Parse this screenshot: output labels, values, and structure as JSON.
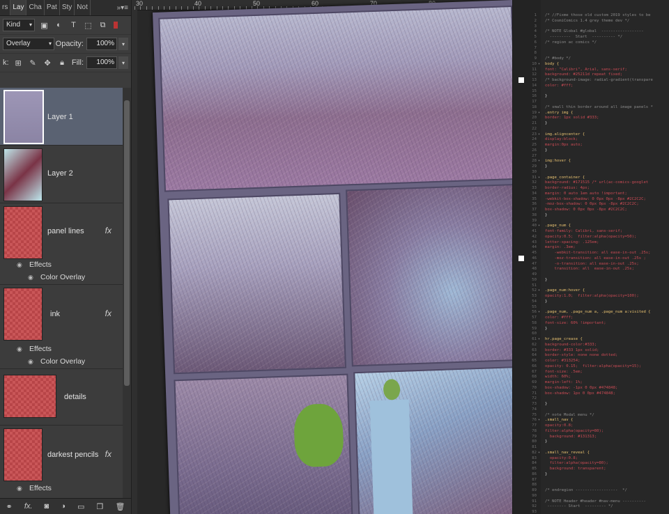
{
  "layers_panel": {
    "tabs": [
      "rs",
      "Lay",
      "Cha",
      "Pat",
      "Sty",
      "Not"
    ],
    "filter_kind": "Kind",
    "blend_mode": "Overlay",
    "opacity_label": "Opacity:",
    "opacity_value": "100%",
    "lock_label": "k:",
    "fill_label": "Fill:",
    "fill_value": "100%",
    "layers": [
      {
        "name": "Layer 1",
        "fx": "",
        "effects": []
      },
      {
        "name": "Layer 2",
        "fx": "",
        "effects": []
      },
      {
        "name": "panel lines",
        "fx": "fx",
        "effects": [
          "Effects",
          "Color Overlay"
        ]
      },
      {
        "name": "ink",
        "fx": "fx",
        "effects": [
          "Effects",
          "Color Overlay"
        ]
      },
      {
        "name": "details",
        "fx": "",
        "effects": []
      },
      {
        "name": "darkest pencils",
        "fx": "fx",
        "effects": [
          "Effects"
        ]
      }
    ],
    "footer_icons": [
      "link-icon",
      "fx-icon",
      "mask-icon",
      "adjustment-icon",
      "folder-icon",
      "new-layer-icon",
      "trash-icon"
    ]
  },
  "ruler": {
    "ticks": [
      "30",
      "40",
      "50",
      "60",
      "70",
      "80",
      "90"
    ]
  },
  "editor": {
    "swatches": [
      {
        "line": 13,
        "color": "#ffffff"
      },
      {
        "line": 46,
        "color": "#ffffff"
      }
    ],
    "lines": [
      {
        "n": "1",
        "f": "",
        "t": "/* //Fixme those old custom 2019 styles to be",
        "k": "com"
      },
      {
        "n": "2",
        "f": "",
        "t": "/* CosmiComics 1.4 grey theme dev */",
        "k": "com"
      },
      {
        "n": "3",
        "f": "",
        "t": "",
        "k": "com"
      },
      {
        "n": "4",
        "f": "",
        "t": "/* NOTE Global #global  ------------------",
        "k": "com"
      },
      {
        "n": "5",
        "f": "",
        "t": "  ---------  Start  ---------- */",
        "k": "com"
      },
      {
        "n": "6",
        "f": "",
        "t": "/* region ac comics */",
        "k": "com"
      },
      {
        "n": "7",
        "f": "",
        "t": "",
        "k": "com"
      },
      {
        "n": "8",
        "f": "",
        "t": "",
        "k": "com"
      },
      {
        "n": "9",
        "f": "",
        "t": "/* #body */",
        "k": "com"
      },
      {
        "n": "10",
        "f": "▾",
        "t": "body {",
        "k": "sel"
      },
      {
        "n": "11",
        "f": "",
        "t": "font: \"Calibri\", Arial, sans-serif;",
        "k": "prop"
      },
      {
        "n": "12",
        "f": "",
        "t": "background: #25211d repeat fixed;",
        "k": "prop"
      },
      {
        "n": "13",
        "f": "",
        "t": "/* background-image: radial-gradient(transpare",
        "k": "com"
      },
      {
        "n": "14",
        "f": "",
        "t": "color: #fff;",
        "k": "prop"
      },
      {
        "n": "15",
        "f": "",
        "t": "",
        "k": "br"
      },
      {
        "n": "16",
        "f": "",
        "t": "}",
        "k": "br"
      },
      {
        "n": "17",
        "f": "",
        "t": "",
        "k": "br"
      },
      {
        "n": "18",
        "f": "",
        "t": "/* small thin border around all image panels *",
        "k": "com"
      },
      {
        "n": "19",
        "f": "▾",
        "t": ".entry img {",
        "k": "sel"
      },
      {
        "n": "20",
        "f": "",
        "t": "border: 1px solid #333;",
        "k": "prop"
      },
      {
        "n": "21",
        "f": "",
        "t": "}",
        "k": "br"
      },
      {
        "n": "22",
        "f": "",
        "t": "",
        "k": "br"
      },
      {
        "n": "23",
        "f": "▾",
        "t": "img.aligncenter {",
        "k": "sel"
      },
      {
        "n": "24",
        "f": "",
        "t": "display:block;",
        "k": "prop"
      },
      {
        "n": "25",
        "f": "",
        "t": "margin:0px auto;",
        "k": "prop"
      },
      {
        "n": "26",
        "f": "",
        "t": "}",
        "k": "br"
      },
      {
        "n": "27",
        "f": "",
        "t": "",
        "k": "br"
      },
      {
        "n": "28",
        "f": "▾",
        "t": "img:hover {",
        "k": "sel"
      },
      {
        "n": "29",
        "f": "",
        "t": "}",
        "k": "br"
      },
      {
        "n": "30",
        "f": "",
        "t": "",
        "k": "br"
      },
      {
        "n": "31",
        "f": "▾",
        "t": ".page_container {",
        "k": "sel"
      },
      {
        "n": "32",
        "f": "",
        "t": "background: #171515 /* url(ac-comics-googlet",
        "k": "prop"
      },
      {
        "n": "33",
        "f": "",
        "t": "border-radius: 4px;",
        "k": "prop"
      },
      {
        "n": "34",
        "f": "",
        "t": "margin: 0 auto 1em auto !important;",
        "k": "prop"
      },
      {
        "n": "35",
        "f": "",
        "t": "-webkit-box-shadow: 0 0px 0px -8px #2C2C2C;",
        "k": "prop"
      },
      {
        "n": "36",
        "f": "",
        "t": "-moz-box-shadow: 0 0px 0px -8px #2C2C2C;",
        "k": "prop"
      },
      {
        "n": "37",
        "f": "",
        "t": "box-shadow: 0 0px 0px -8px #2C2C2C;",
        "k": "prop"
      },
      {
        "n": "38",
        "f": "",
        "t": "}",
        "k": "br"
      },
      {
        "n": "39",
        "f": "",
        "t": "",
        "k": "br"
      },
      {
        "n": "40",
        "f": "▾",
        "t": ".page_num {",
        "k": "sel"
      },
      {
        "n": "41",
        "f": "",
        "t": "font-family: Calibri, sans-serif;",
        "k": "prop"
      },
      {
        "n": "42",
        "f": "",
        "t": "opacity:0.5;  filter:alpha(opacity=50);",
        "k": "prop"
      },
      {
        "n": "43",
        "f": "",
        "t": "letter-spacing: .125em;",
        "k": "prop"
      },
      {
        "n": "44",
        "f": "",
        "t": "margin: .3em;",
        "k": "prop"
      },
      {
        "n": "45",
        "f": "",
        "t": "    -webkit-transition: all ease-in-out .25s;",
        "k": "prop"
      },
      {
        "n": "46",
        "f": "",
        "t": "    -moz-transition: all ease-in-out .25s ;",
        "k": "prop"
      },
      {
        "n": "47",
        "f": "",
        "t": "    -o-transition: all ease-in-out .25s;",
        "k": "prop"
      },
      {
        "n": "48",
        "f": "",
        "t": "    transition: all  ease-in-out .25s;",
        "k": "prop"
      },
      {
        "n": "49",
        "f": "",
        "t": "",
        "k": "br"
      },
      {
        "n": "50",
        "f": "",
        "t": "}",
        "k": "br"
      },
      {
        "n": "51",
        "f": "",
        "t": "",
        "k": "br"
      },
      {
        "n": "52",
        "f": "▾",
        "t": ".page_num:hover {",
        "k": "sel"
      },
      {
        "n": "53",
        "f": "",
        "t": "opacity:1.0;  filter:alpha(opacity=100);",
        "k": "prop"
      },
      {
        "n": "54",
        "f": "",
        "t": "}",
        "k": "br"
      },
      {
        "n": "55",
        "f": "",
        "t": "",
        "k": "br"
      },
      {
        "n": "56",
        "f": "▾",
        "t": ".page_num, .page_num a, .page_num a:visited {",
        "k": "sel"
      },
      {
        "n": "57",
        "f": "",
        "t": "color: #fff;",
        "k": "prop"
      },
      {
        "n": "58",
        "f": "",
        "t": "font-size: 60% !important;",
        "k": "prop"
      },
      {
        "n": "59",
        "f": "",
        "t": "}",
        "k": "br"
      },
      {
        "n": "60",
        "f": "",
        "t": "",
        "k": "br"
      },
      {
        "n": "61",
        "f": "▾",
        "t": "hr.page_crease {",
        "k": "sel"
      },
      {
        "n": "62",
        "f": "",
        "t": "background-color:#333;",
        "k": "prop"
      },
      {
        "n": "63",
        "f": "",
        "t": "border: #333 1px solid;",
        "k": "prop"
      },
      {
        "n": "64",
        "f": "",
        "t": "border-style: none none dotted;",
        "k": "prop"
      },
      {
        "n": "65",
        "f": "",
        "t": "color: #313254;",
        "k": "prop"
      },
      {
        "n": "66",
        "f": "",
        "t": "opacity: 0.15;  filter:alpha(opacity=15);",
        "k": "prop"
      },
      {
        "n": "67",
        "f": "",
        "t": "font-size: .5em;",
        "k": "prop"
      },
      {
        "n": "68",
        "f": "",
        "t": "width: 60%;",
        "k": "prop"
      },
      {
        "n": "69",
        "f": "",
        "t": "margin-left: 1%;",
        "k": "prop"
      },
      {
        "n": "70",
        "f": "",
        "t": "box-shadow: -1px 0 0px #474848;",
        "k": "prop"
      },
      {
        "n": "71",
        "f": "",
        "t": "box-shadow: 1px 0 0px #474848;",
        "k": "prop"
      },
      {
        "n": "72",
        "f": "",
        "t": "",
        "k": "br"
      },
      {
        "n": "73",
        "f": "",
        "t": "}",
        "k": "br"
      },
      {
        "n": "74",
        "f": "",
        "t": "",
        "k": "br"
      },
      {
        "n": "75",
        "f": "",
        "t": "/* note Modal menu */",
        "k": "com"
      },
      {
        "n": "76",
        "f": "▾",
        "t": ".small_nav {",
        "k": "sel"
      },
      {
        "n": "77",
        "f": "",
        "t": "opacity:0.8;",
        "k": "prop"
      },
      {
        "n": "78",
        "f": "",
        "t": "filter:alpha(opacity=80);",
        "k": "prop"
      },
      {
        "n": "79",
        "f": "",
        "t": "  background: #131313;",
        "k": "prop"
      },
      {
        "n": "80",
        "f": "",
        "t": "}",
        "k": "br"
      },
      {
        "n": "81",
        "f": "",
        "t": "",
        "k": "br"
      },
      {
        "n": "82",
        "f": "▾",
        "t": ".small_nav_reveal {",
        "k": "sel"
      },
      {
        "n": "83",
        "f": "",
        "t": "  opacity:0.8;",
        "k": "prop"
      },
      {
        "n": "84",
        "f": "",
        "t": "  filter:alpha(opacity=80);",
        "k": "prop"
      },
      {
        "n": "85",
        "f": "",
        "t": "  background: transparent;",
        "k": "prop"
      },
      {
        "n": "86",
        "f": "",
        "t": "}",
        "k": "br"
      },
      {
        "n": "87",
        "f": "",
        "t": "",
        "k": "br"
      },
      {
        "n": "88",
        "f": "",
        "t": "",
        "k": "br"
      },
      {
        "n": "89",
        "f": "",
        "t": "/* endregion ------------------  */",
        "k": "com"
      },
      {
        "n": "90",
        "f": "",
        "t": "",
        "k": "br"
      },
      {
        "n": "91",
        "f": "",
        "t": "/* NOTE Header #header #nav-menu ----------",
        "k": "com"
      },
      {
        "n": "92",
        "f": "",
        "t": " -------- Start  --------- */",
        "k": "com"
      },
      {
        "n": "93",
        "f": "",
        "t": "",
        "k": "br"
      },
      {
        "n": "94",
        "f": "",
        "t": "#progressWrapper { background-color: #2B2B2D;}",
        "k": "sel"
      }
    ]
  }
}
